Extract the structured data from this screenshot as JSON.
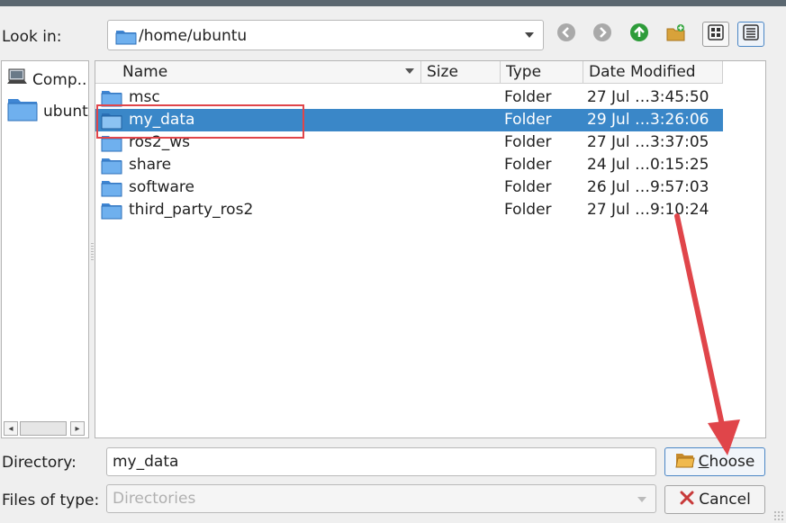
{
  "look_in": {
    "label": "Look in:",
    "path": "/home/ubuntu"
  },
  "toolbar": {
    "icons": [
      "back-icon",
      "forward-icon",
      "parent-dir-icon",
      "new-folder-icon",
      "list-view-icon",
      "detail-view-icon"
    ]
  },
  "sidebar": {
    "items": [
      {
        "label": "Comp..",
        "icon": "computer-icon"
      },
      {
        "label": "ubunt",
        "icon": "folder-icon"
      }
    ]
  },
  "columns": {
    "name": "Name",
    "size": "Size",
    "type": "Type",
    "date": "Date Modified"
  },
  "files": [
    {
      "name": "msc",
      "type": "Folder",
      "date": "27 Jul …3:45:50"
    },
    {
      "name": "my_data",
      "type": "Folder",
      "date": "29 Jul …3:26:06",
      "selected": true
    },
    {
      "name": "ros2_ws",
      "type": "Folder",
      "date": "27 Jul …3:37:05"
    },
    {
      "name": "share",
      "type": "Folder",
      "date": "24 Jul …0:15:25"
    },
    {
      "name": "software",
      "type": "Folder",
      "date": "26 Jul …9:57:03"
    },
    {
      "name": "third_party_ros2",
      "type": "Folder",
      "date": "27 Jul …9:10:24"
    }
  ],
  "directory": {
    "label": "Directory:",
    "value": "my_data"
  },
  "files_of_type": {
    "label": "Files of type:",
    "value": "Directories"
  },
  "buttons": {
    "choose_first": "C",
    "choose_rest": "hoose",
    "cancel": "Cancel"
  },
  "colors": {
    "selection": "#3a87c8",
    "annotation": "#e0454a"
  }
}
